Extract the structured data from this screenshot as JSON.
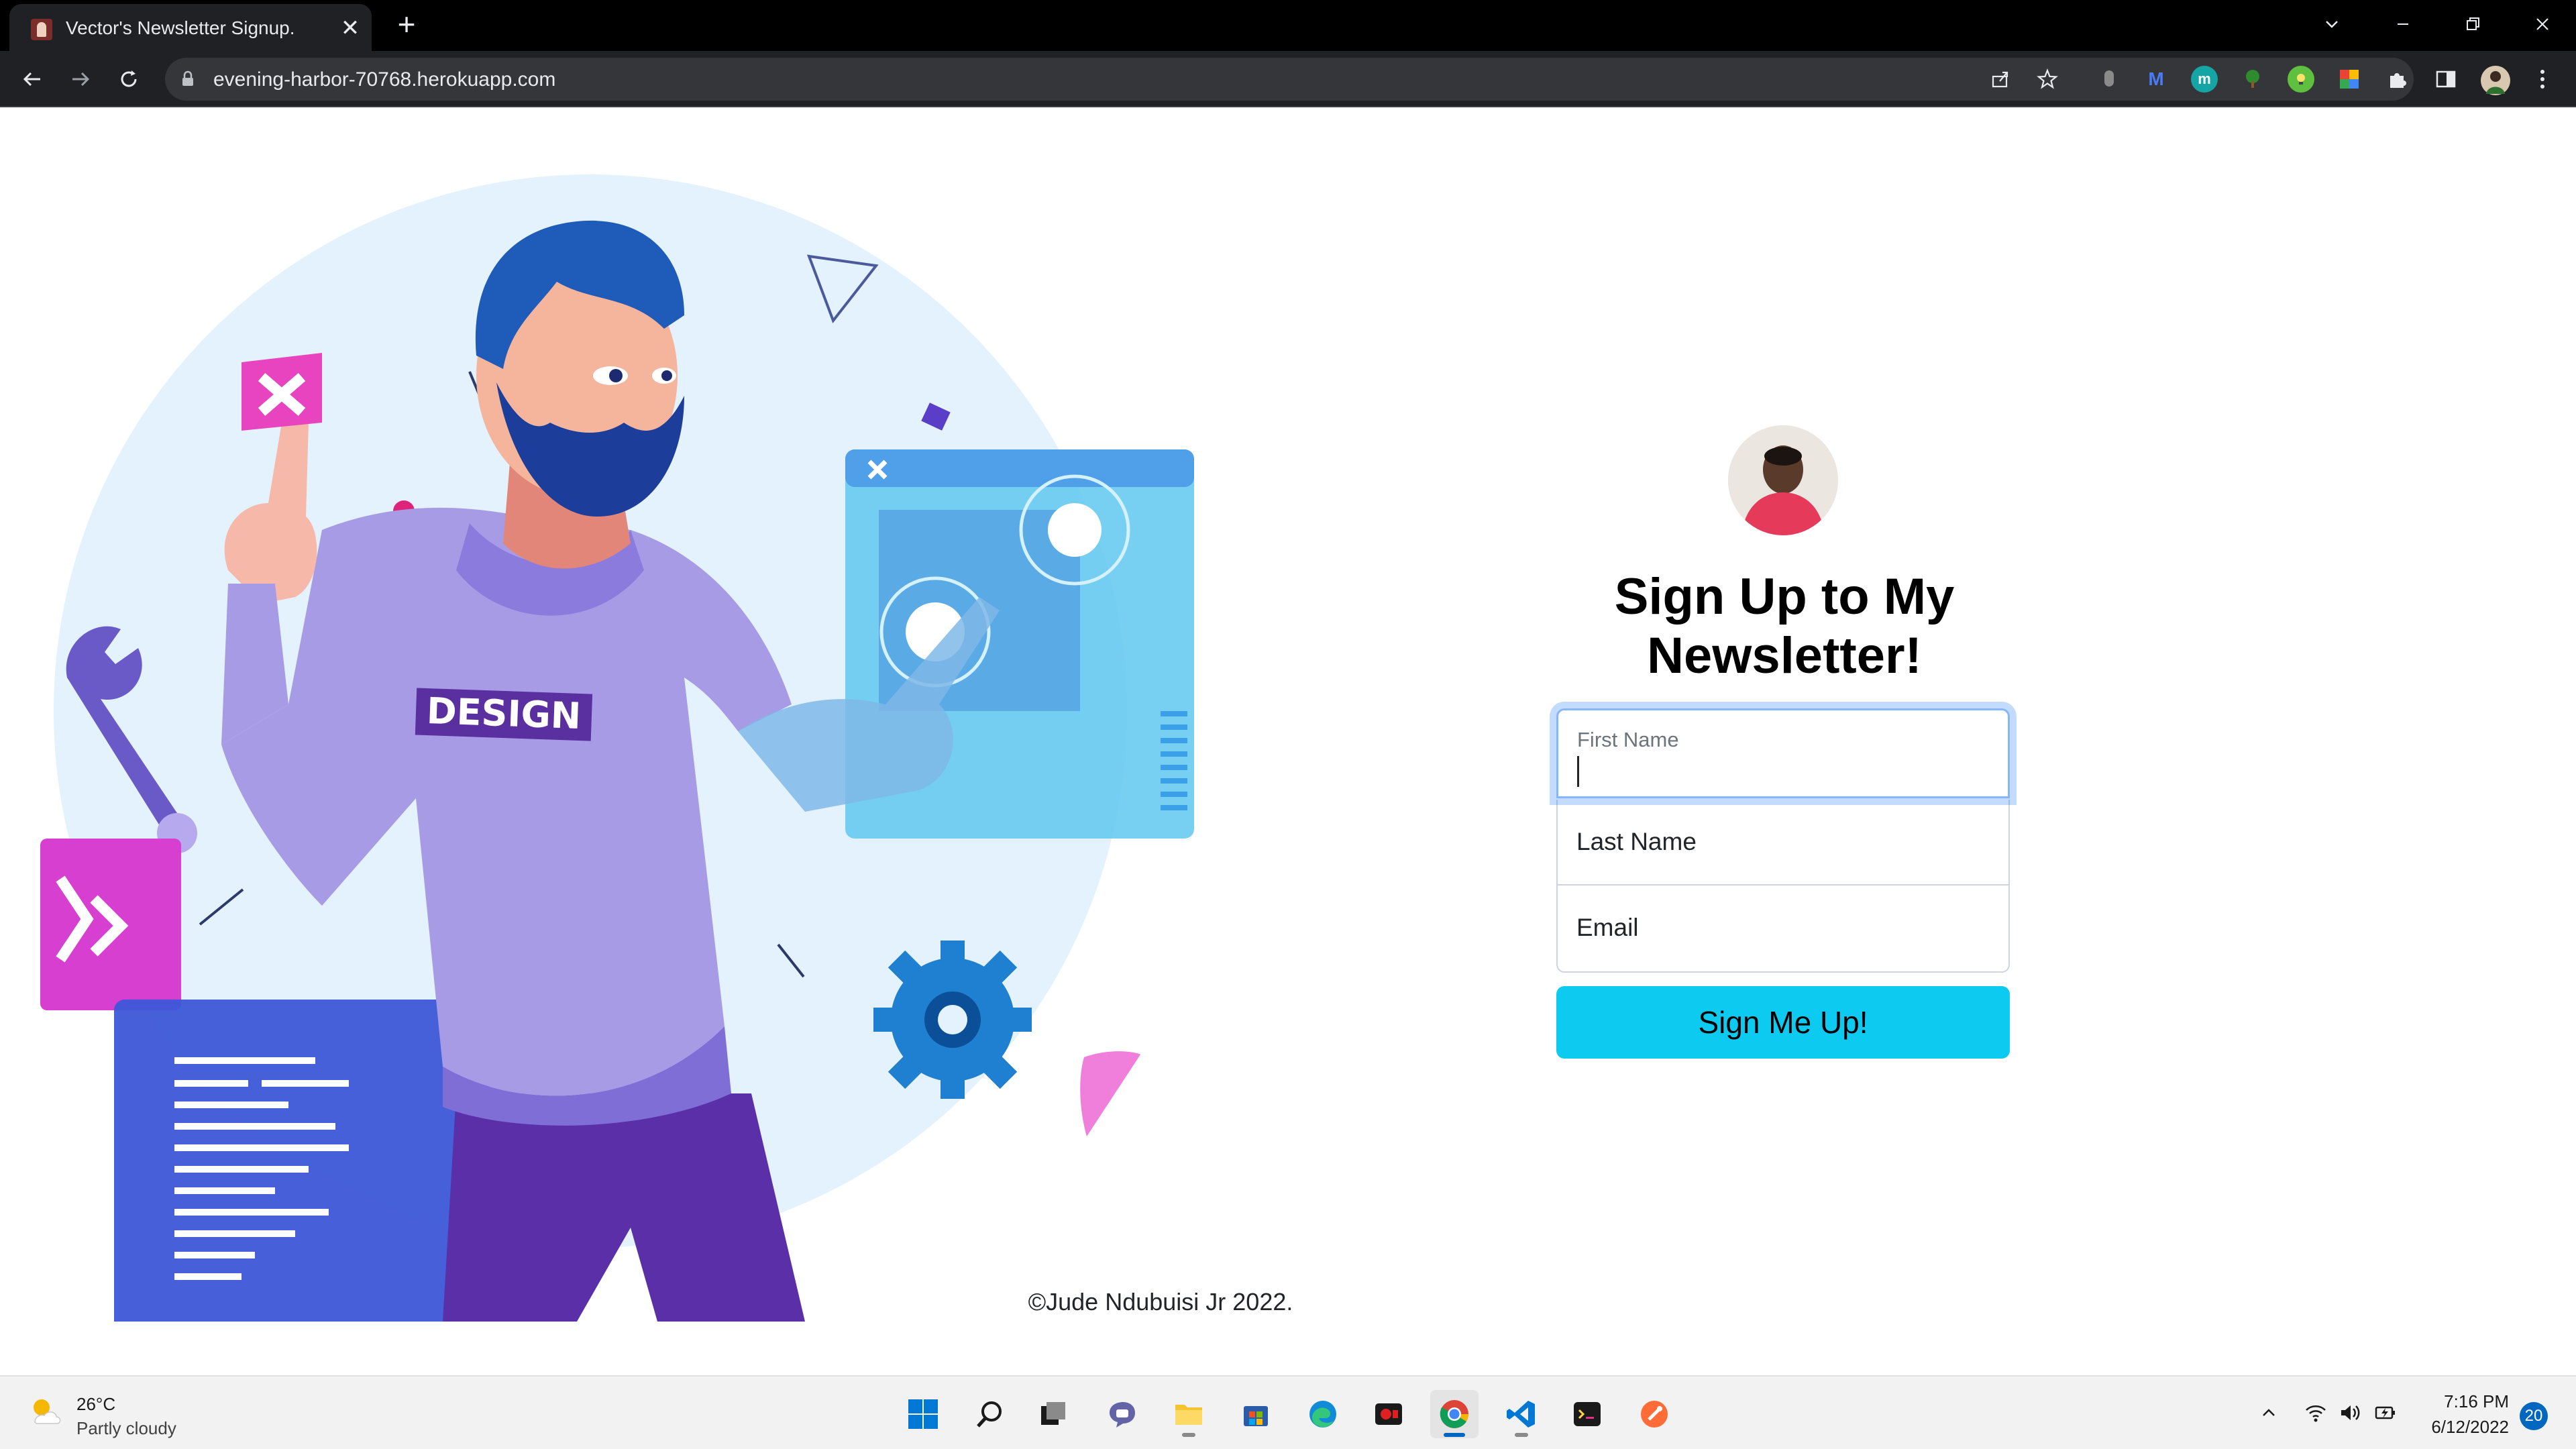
{
  "browser": {
    "tab_title": "Vector's Newsletter Signup.",
    "tab_close": "✕",
    "new_tab": "+",
    "url": "evening-harbor-70768.herokuapp.com",
    "favicon": "avatar-favicon"
  },
  "illustration": {
    "shirt_text": "DESIGN",
    "icons": [
      "close-sign-icon",
      "wrench-icon",
      "gear-icon",
      "code-window-icon",
      "touch-window-icon"
    ]
  },
  "form": {
    "title": "Sign Up to My Newsletter!",
    "first_name_label": "First Name",
    "last_name_placeholder": "Last Name",
    "email_placeholder": "Email",
    "submit_label": "Sign Me Up!",
    "submit_color": "#0dcaf0"
  },
  "footer": {
    "copyright": "©Jude Ndubuisi Jr 2022."
  },
  "taskbar": {
    "weather_temp": "26°C",
    "weather_desc": "Partly cloudy",
    "time": "7:16 PM",
    "date": "6/12/2022",
    "notifications": "20"
  }
}
